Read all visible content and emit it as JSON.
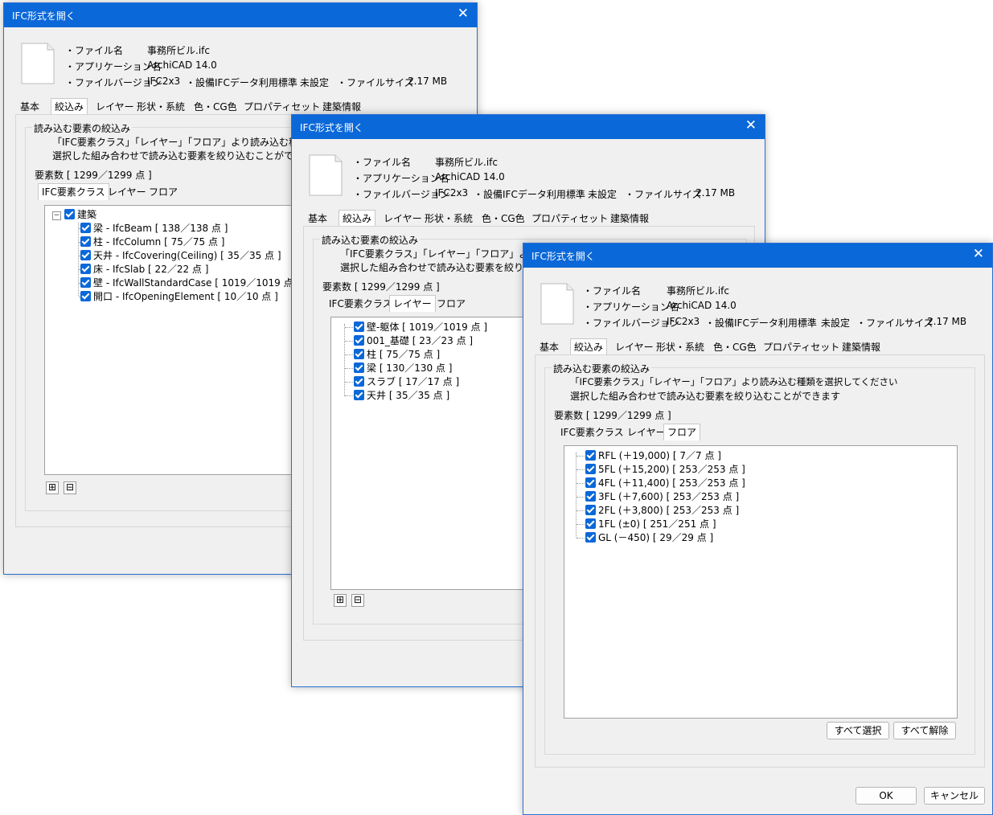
{
  "dialog_title": "IFC形式を開く",
  "info": {
    "file_name_label": "・ファイル名",
    "file_name": "事務所ビル.ifc",
    "app_label": "・アプリケーション名",
    "app_name": "ArchiCAD 14.0",
    "version_label": "・ファイルバージョン",
    "version": "IFC2x3",
    "standard_label": "・設備IFCデータ利用標準",
    "standard": "未設定",
    "size_label": "・ファイルサイズ",
    "size": "2.17 MB"
  },
  "tabs": [
    "基本",
    "絞込み",
    "レイヤー",
    "形状・系統",
    "色・CG色",
    "プロパティセット",
    "建築情報"
  ],
  "group_label": "読み込む要素の絞込み",
  "desc_line1": "「IFC要素クラス」「レイヤー」「フロア」より読み込む種類を選択してください",
  "desc_line2": "選択した組み合わせで読み込む要素を絞り込むことができます",
  "desc_line1_cut1": "「IFC要素クラス」「レイヤー」「フロア」より読み込む種類を選択",
  "desc_line2_cut1": "選択した組み合わせで読み込む要素を絞り込むことができます",
  "desc_line1_cut2": "「IFC要素クラス」「レイヤー」「フロア」より読み込",
  "desc_line2_cut2": "選択した組み合わせで読み込む要素を絞り込",
  "element_count": "要素数 [ 1299／1299 点 ]",
  "subtabs": [
    "IFC要素クラス",
    "レイヤー",
    "フロア"
  ],
  "class_tree": {
    "root": "建築",
    "items": [
      "梁 - IfcBeam [ 138／138 点 ]",
      "柱 - IfcColumn [ 75／75 点 ]",
      "天井 - IfcCovering(Ceiling) [ 35／35 点 ]",
      "床 - IfcSlab [ 22／22 点 ]",
      "壁 - IfcWallStandardCase [ 1019／1019 点 ]",
      "開口 - IfcOpeningElement [ 10／10 点 ]"
    ]
  },
  "layer_tree": {
    "items": [
      "壁-躯体 [ 1019／1019 点 ]",
      "001_基礎 [ 23／23 点 ]",
      "柱 [ 75／75 点 ]",
      "梁 [ 130／130 点 ]",
      "スラブ [ 17／17 点 ]",
      "天井 [ 35／35 点 ]"
    ]
  },
  "floor_tree": {
    "items": [
      "RFL (＋19,000) [ 7／7 点 ]",
      "5FL (＋15,200) [ 253／253 点 ]",
      "4FL (＋11,400) [ 253／253 点 ]",
      "3FL (＋7,600) [ 253／253 点 ]",
      "2FL (＋3,800) [ 253／253 点 ]",
      "1FL (±0) [ 251／251 点 ]",
      "GL (－450) [ 29／29 点 ]"
    ]
  },
  "expand_all": "⊞",
  "collapse_all": "⊟",
  "collapse_root": "−",
  "close_glyph": "✕",
  "select_all": "すべて選択",
  "deselect_all": "すべて解除",
  "ok": "OK",
  "cancel": "キャンセル",
  "colors": {
    "title_bar": "#0b68d8",
    "checkbox": "#0b68d8",
    "dialog_bg": "#f0f0f0"
  }
}
